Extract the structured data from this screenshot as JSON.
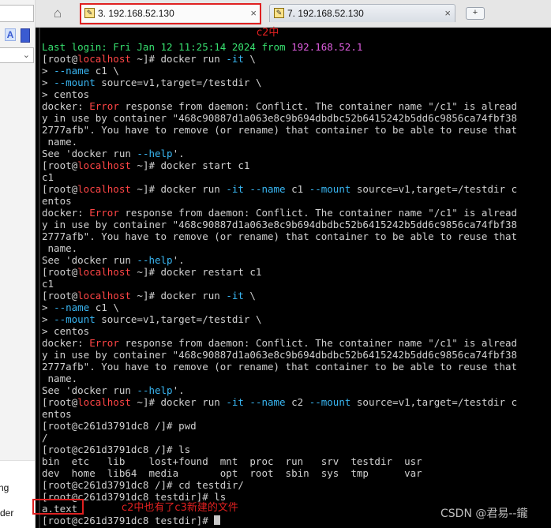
{
  "left_panel": {
    "label_a": "A",
    "items": [
      "ng",
      "der"
    ]
  },
  "tabs": [
    {
      "label": "3. 192.168.52.130",
      "active": true,
      "close": "×"
    },
    {
      "label": "7. 192.168.52.130",
      "active": false,
      "close": "×"
    }
  ],
  "tab_add_label": "+",
  "annotations": {
    "tab_note": "c2中",
    "file_note": "c2中也有了c3新建的文件"
  },
  "watermark": "CSDN @君易--鑨",
  "colors": {
    "background": "#000000",
    "text": "#d0d0d0",
    "green": "#37e06f",
    "cyan": "#39b6f2",
    "red": "#ff4545",
    "magenta": "#e05ee0",
    "annotation": "#e02020"
  },
  "terminal": {
    "lines": [
      [
        [
          "Last login: Fri Jan 12 11:25:14 2024 from ",
          "green"
        ],
        [
          "192.168.52.1",
          "magenta"
        ]
      ],
      [
        [
          "[root@",
          "white"
        ],
        [
          "localhost",
          "red"
        ],
        [
          " ~]# docker run ",
          "white"
        ],
        [
          "-it",
          "cyan"
        ],
        [
          " \\",
          "white"
        ]
      ],
      [
        [
          "> ",
          "white"
        ],
        [
          "--name",
          "cyan"
        ],
        [
          " c1 \\",
          "white"
        ]
      ],
      [
        [
          "> ",
          "white"
        ],
        [
          "--mount",
          "cyan"
        ],
        [
          " source=v1,target=/testdir \\",
          "white"
        ]
      ],
      [
        [
          "> centos",
          "white"
        ]
      ],
      [
        [
          "docker: ",
          "white"
        ],
        [
          "Error",
          "red"
        ],
        [
          " response from daemon: Conflict. The container name \"/c1\" is alread",
          "white"
        ]
      ],
      [
        [
          "y in use by container \"468c90887d1a063e8c9b694dbdbc52b6415242b5dd6c9856ca74fbf38",
          "white"
        ]
      ],
      [
        [
          "2777afb\". You have to remove (or rename) that container to be able to reuse that",
          "white"
        ]
      ],
      [
        [
          " name.",
          "white"
        ]
      ],
      [
        [
          "See 'docker run ",
          "white"
        ],
        [
          "--help",
          "cyan"
        ],
        [
          "'.",
          "white"
        ]
      ],
      [
        [
          "[root@",
          "white"
        ],
        [
          "localhost",
          "red"
        ],
        [
          " ~]# docker start c1",
          "white"
        ]
      ],
      [
        [
          "c1",
          "white"
        ]
      ],
      [
        [
          "[root@",
          "white"
        ],
        [
          "localhost",
          "red"
        ],
        [
          " ~]# docker run ",
          "white"
        ],
        [
          "-it",
          "cyan"
        ],
        [
          " ",
          "white"
        ],
        [
          "--name",
          "cyan"
        ],
        [
          " c1 ",
          "white"
        ],
        [
          "--mount",
          "cyan"
        ],
        [
          " source=v1,target=/testdir c",
          "white"
        ]
      ],
      [
        [
          "entos",
          "white"
        ]
      ],
      [
        [
          "docker: ",
          "white"
        ],
        [
          "Error",
          "red"
        ],
        [
          " response from daemon: Conflict. The container name \"/c1\" is alread",
          "white"
        ]
      ],
      [
        [
          "y in use by container \"468c90887d1a063e8c9b694dbdbc52b6415242b5dd6c9856ca74fbf38",
          "white"
        ]
      ],
      [
        [
          "2777afb\". You have to remove (or rename) that container to be able to reuse that",
          "white"
        ]
      ],
      [
        [
          " name.",
          "white"
        ]
      ],
      [
        [
          "See 'docker run ",
          "white"
        ],
        [
          "--help",
          "cyan"
        ],
        [
          "'.",
          "white"
        ]
      ],
      [
        [
          "[root@",
          "white"
        ],
        [
          "localhost",
          "red"
        ],
        [
          " ~]# docker restart c1",
          "white"
        ]
      ],
      [
        [
          "c1",
          "white"
        ]
      ],
      [
        [
          "[root@",
          "white"
        ],
        [
          "localhost",
          "red"
        ],
        [
          " ~]# docker run ",
          "white"
        ],
        [
          "-it",
          "cyan"
        ],
        [
          " \\",
          "white"
        ]
      ],
      [
        [
          "> ",
          "white"
        ],
        [
          "--name",
          "cyan"
        ],
        [
          " c1 \\",
          "white"
        ]
      ],
      [
        [
          "> ",
          "white"
        ],
        [
          "--mount",
          "cyan"
        ],
        [
          " source=v1,target=/testdir \\",
          "white"
        ]
      ],
      [
        [
          "> centos",
          "white"
        ]
      ],
      [
        [
          "docker: ",
          "white"
        ],
        [
          "Error",
          "red"
        ],
        [
          " response from daemon: Conflict. The container name \"/c1\" is alread",
          "white"
        ]
      ],
      [
        [
          "y in use by container \"468c90887d1a063e8c9b694dbdbc52b6415242b5dd6c9856ca74fbf38",
          "white"
        ]
      ],
      [
        [
          "2777afb\". You have to remove (or rename) that container to be able to reuse that",
          "white"
        ]
      ],
      [
        [
          " name.",
          "white"
        ]
      ],
      [
        [
          "See 'docker run ",
          "white"
        ],
        [
          "--help",
          "cyan"
        ],
        [
          "'.",
          "white"
        ]
      ],
      [
        [
          "[root@",
          "white"
        ],
        [
          "localhost",
          "red"
        ],
        [
          " ~]# docker run ",
          "white"
        ],
        [
          "-it",
          "cyan"
        ],
        [
          " ",
          "white"
        ],
        [
          "--name",
          "cyan"
        ],
        [
          " c2 ",
          "white"
        ],
        [
          "--mount",
          "cyan"
        ],
        [
          " source=v1,target=/testdir c",
          "white"
        ]
      ],
      [
        [
          "entos",
          "white"
        ]
      ],
      [
        [
          "[root@c261d3791dc8 /]# pwd",
          "white"
        ]
      ],
      [
        [
          "/",
          "white"
        ]
      ],
      [
        [
          "[root@c261d3791dc8 /]# ls",
          "white"
        ]
      ],
      [
        [
          "bin  etc   lib    lost+found  mnt  proc  run   srv  testdir  usr",
          "white"
        ]
      ],
      [
        [
          "dev  home  lib64  media       opt  root  sbin  sys  tmp      var",
          "white"
        ]
      ],
      [
        [
          "[root@c261d3791dc8 /]# cd testdir/",
          "white"
        ]
      ],
      [
        [
          "[root@c261d3791dc8 testdir]# ls",
          "white"
        ]
      ],
      [
        [
          "a.text",
          "white"
        ]
      ],
      [
        [
          "[root@c261d3791dc8 testdir]# ",
          "white"
        ]
      ]
    ]
  }
}
